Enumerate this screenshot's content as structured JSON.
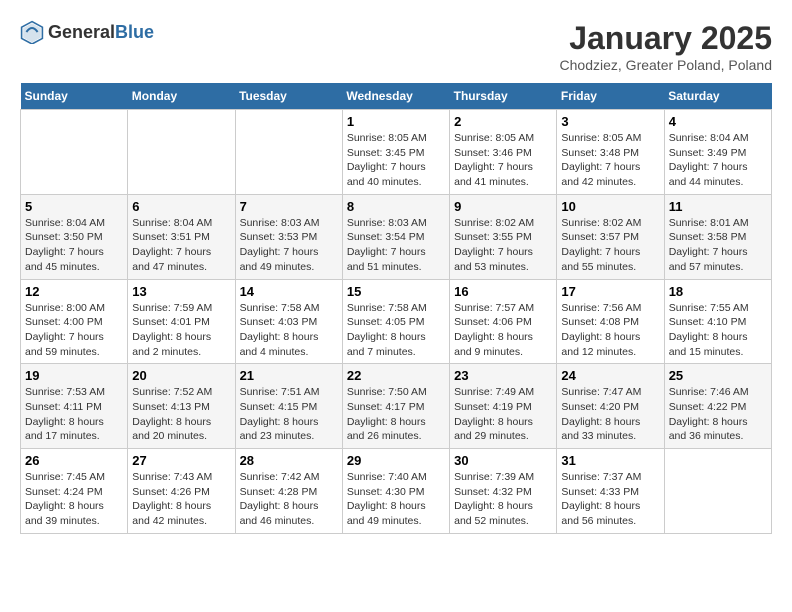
{
  "header": {
    "logo_general": "General",
    "logo_blue": "Blue",
    "title": "January 2025",
    "subtitle": "Chodziez, Greater Poland, Poland"
  },
  "weekdays": [
    "Sunday",
    "Monday",
    "Tuesday",
    "Wednesday",
    "Thursday",
    "Friday",
    "Saturday"
  ],
  "weeks": [
    [
      {
        "day": "",
        "info": ""
      },
      {
        "day": "",
        "info": ""
      },
      {
        "day": "",
        "info": ""
      },
      {
        "day": "1",
        "info": "Sunrise: 8:05 AM\nSunset: 3:45 PM\nDaylight: 7 hours\nand 40 minutes."
      },
      {
        "day": "2",
        "info": "Sunrise: 8:05 AM\nSunset: 3:46 PM\nDaylight: 7 hours\nand 41 minutes."
      },
      {
        "day": "3",
        "info": "Sunrise: 8:05 AM\nSunset: 3:48 PM\nDaylight: 7 hours\nand 42 minutes."
      },
      {
        "day": "4",
        "info": "Sunrise: 8:04 AM\nSunset: 3:49 PM\nDaylight: 7 hours\nand 44 minutes."
      }
    ],
    [
      {
        "day": "5",
        "info": "Sunrise: 8:04 AM\nSunset: 3:50 PM\nDaylight: 7 hours\nand 45 minutes."
      },
      {
        "day": "6",
        "info": "Sunrise: 8:04 AM\nSunset: 3:51 PM\nDaylight: 7 hours\nand 47 minutes."
      },
      {
        "day": "7",
        "info": "Sunrise: 8:03 AM\nSunset: 3:53 PM\nDaylight: 7 hours\nand 49 minutes."
      },
      {
        "day": "8",
        "info": "Sunrise: 8:03 AM\nSunset: 3:54 PM\nDaylight: 7 hours\nand 51 minutes."
      },
      {
        "day": "9",
        "info": "Sunrise: 8:02 AM\nSunset: 3:55 PM\nDaylight: 7 hours\nand 53 minutes."
      },
      {
        "day": "10",
        "info": "Sunrise: 8:02 AM\nSunset: 3:57 PM\nDaylight: 7 hours\nand 55 minutes."
      },
      {
        "day": "11",
        "info": "Sunrise: 8:01 AM\nSunset: 3:58 PM\nDaylight: 7 hours\nand 57 minutes."
      }
    ],
    [
      {
        "day": "12",
        "info": "Sunrise: 8:00 AM\nSunset: 4:00 PM\nDaylight: 7 hours\nand 59 minutes."
      },
      {
        "day": "13",
        "info": "Sunrise: 7:59 AM\nSunset: 4:01 PM\nDaylight: 8 hours\nand 2 minutes."
      },
      {
        "day": "14",
        "info": "Sunrise: 7:58 AM\nSunset: 4:03 PM\nDaylight: 8 hours\nand 4 minutes."
      },
      {
        "day": "15",
        "info": "Sunrise: 7:58 AM\nSunset: 4:05 PM\nDaylight: 8 hours\nand 7 minutes."
      },
      {
        "day": "16",
        "info": "Sunrise: 7:57 AM\nSunset: 4:06 PM\nDaylight: 8 hours\nand 9 minutes."
      },
      {
        "day": "17",
        "info": "Sunrise: 7:56 AM\nSunset: 4:08 PM\nDaylight: 8 hours\nand 12 minutes."
      },
      {
        "day": "18",
        "info": "Sunrise: 7:55 AM\nSunset: 4:10 PM\nDaylight: 8 hours\nand 15 minutes."
      }
    ],
    [
      {
        "day": "19",
        "info": "Sunrise: 7:53 AM\nSunset: 4:11 PM\nDaylight: 8 hours\nand 17 minutes."
      },
      {
        "day": "20",
        "info": "Sunrise: 7:52 AM\nSunset: 4:13 PM\nDaylight: 8 hours\nand 20 minutes."
      },
      {
        "day": "21",
        "info": "Sunrise: 7:51 AM\nSunset: 4:15 PM\nDaylight: 8 hours\nand 23 minutes."
      },
      {
        "day": "22",
        "info": "Sunrise: 7:50 AM\nSunset: 4:17 PM\nDaylight: 8 hours\nand 26 minutes."
      },
      {
        "day": "23",
        "info": "Sunrise: 7:49 AM\nSunset: 4:19 PM\nDaylight: 8 hours\nand 29 minutes."
      },
      {
        "day": "24",
        "info": "Sunrise: 7:47 AM\nSunset: 4:20 PM\nDaylight: 8 hours\nand 33 minutes."
      },
      {
        "day": "25",
        "info": "Sunrise: 7:46 AM\nSunset: 4:22 PM\nDaylight: 8 hours\nand 36 minutes."
      }
    ],
    [
      {
        "day": "26",
        "info": "Sunrise: 7:45 AM\nSunset: 4:24 PM\nDaylight: 8 hours\nand 39 minutes."
      },
      {
        "day": "27",
        "info": "Sunrise: 7:43 AM\nSunset: 4:26 PM\nDaylight: 8 hours\nand 42 minutes."
      },
      {
        "day": "28",
        "info": "Sunrise: 7:42 AM\nSunset: 4:28 PM\nDaylight: 8 hours\nand 46 minutes."
      },
      {
        "day": "29",
        "info": "Sunrise: 7:40 AM\nSunset: 4:30 PM\nDaylight: 8 hours\nand 49 minutes."
      },
      {
        "day": "30",
        "info": "Sunrise: 7:39 AM\nSunset: 4:32 PM\nDaylight: 8 hours\nand 52 minutes."
      },
      {
        "day": "31",
        "info": "Sunrise: 7:37 AM\nSunset: 4:33 PM\nDaylight: 8 hours\nand 56 minutes."
      },
      {
        "day": "",
        "info": ""
      }
    ]
  ]
}
